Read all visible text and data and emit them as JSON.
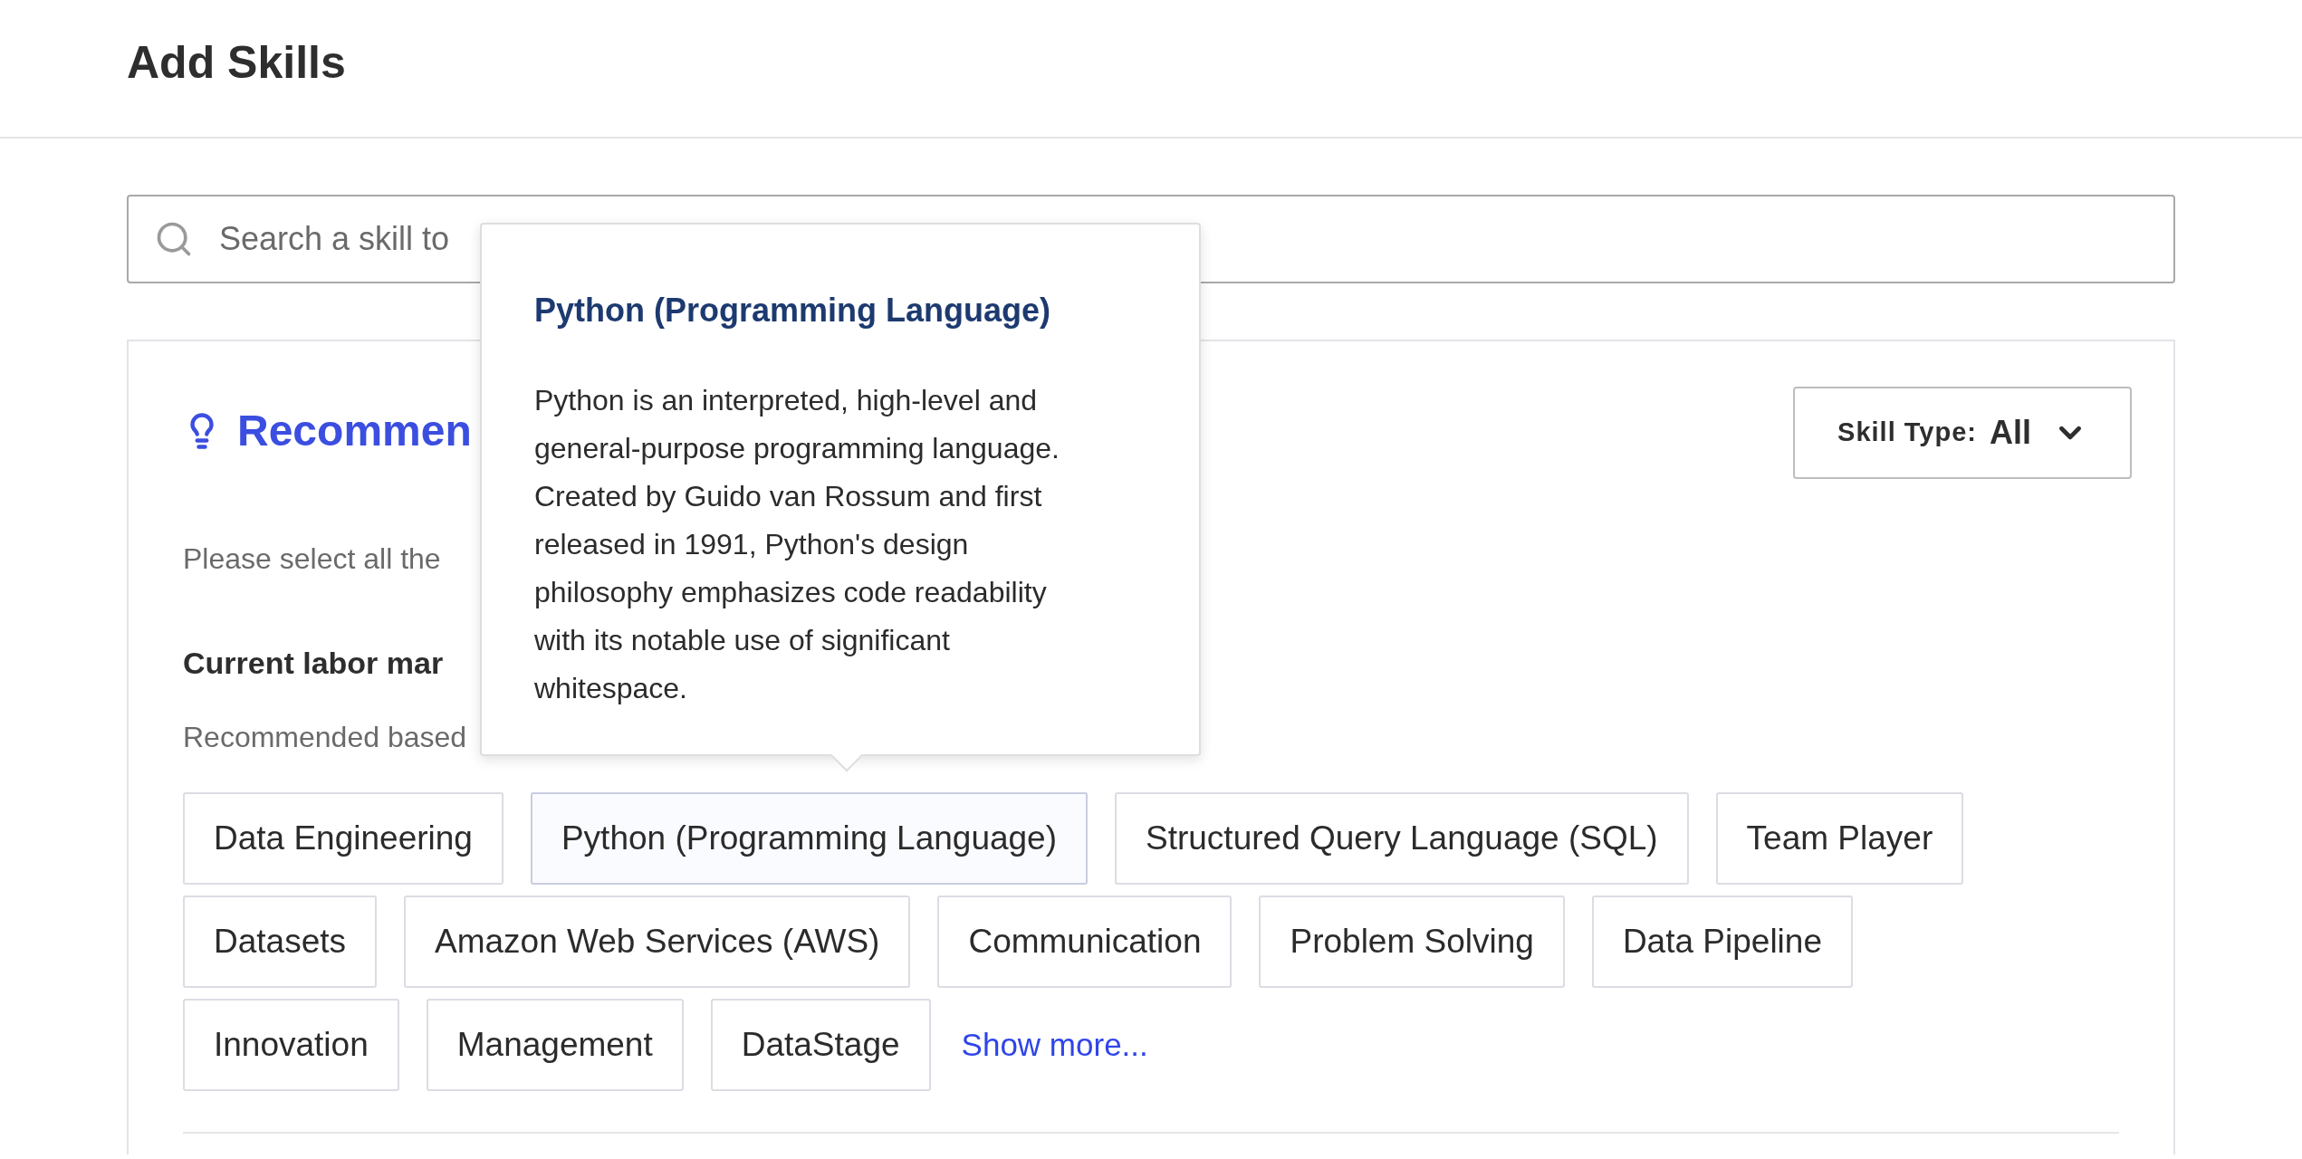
{
  "page_title": "Add Skills",
  "search": {
    "placeholder": "Search a skill to"
  },
  "recommended": {
    "title": "Recommen",
    "filter": {
      "label": "Skill Type:",
      "value": "All"
    },
    "instruction": "Please select all the",
    "section_title": "Current labor mar",
    "section_note": "Recommended based",
    "skills": [
      {
        "label": "Data Engineering",
        "hovered": false
      },
      {
        "label": "Python (Programming Language)",
        "hovered": true
      },
      {
        "label": "Structured Query Language (SQL)",
        "hovered": false
      },
      {
        "label": "Team Player",
        "hovered": false
      },
      {
        "label": "Datasets",
        "hovered": false
      },
      {
        "label": "Amazon Web Services (AWS)",
        "hovered": false
      },
      {
        "label": "Communication",
        "hovered": false
      },
      {
        "label": "Problem Solving",
        "hovered": false
      },
      {
        "label": "Data Pipeline",
        "hovered": false
      },
      {
        "label": "Innovation",
        "hovered": false
      },
      {
        "label": "Management",
        "hovered": false
      },
      {
        "label": "DataStage",
        "hovered": false
      }
    ],
    "show_more": "Show more..."
  },
  "tooltip": {
    "title": "Python (Programming Language)",
    "body": "Python is an interpreted, high-level and general-purpose programming language. Created by Guido van Rossum and first released in 1991, Python's design philosophy emphasizes code readability with its notable use of significant whitespace."
  }
}
